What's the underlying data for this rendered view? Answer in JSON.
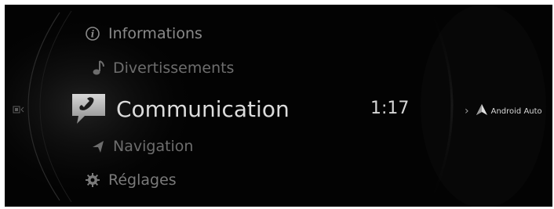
{
  "menu": {
    "items": [
      {
        "label": "Informations",
        "icon": "info-icon"
      },
      {
        "label": "Divertissements",
        "icon": "music-note-icon"
      },
      {
        "label": "Communication",
        "icon": "phone-handset-icon",
        "selected": true
      },
      {
        "label": "Navigation",
        "icon": "navigation-arrow-icon"
      },
      {
        "label": "Réglages",
        "icon": "gear-icon"
      }
    ]
  },
  "status": {
    "time": "1:17"
  },
  "android_auto": {
    "label": "Android Auto",
    "icon": "android-auto-icon",
    "chevron": "›"
  },
  "colors": {
    "background": "#030303",
    "selected_text": "#dcdcdc",
    "dim_text": "#6d6d6d"
  }
}
